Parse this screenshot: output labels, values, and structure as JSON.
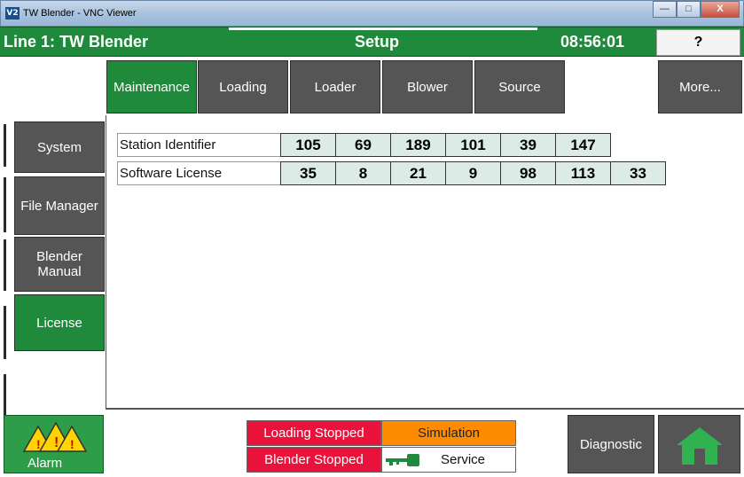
{
  "window": {
    "title": "TW Blender - VNC Viewer",
    "logo_text": "V2",
    "minimize_glyph": "—",
    "maximize_glyph": "□",
    "close_glyph": "X"
  },
  "header": {
    "line_title": "Line 1: TW Blender",
    "screen_title": "Setup",
    "clock": "08:56:01",
    "help_label": "?"
  },
  "tabs": [
    {
      "label": "Maintenance",
      "active": true
    },
    {
      "label": "Loading",
      "active": false
    },
    {
      "label": "Loader",
      "active": false
    },
    {
      "label": "Blower",
      "active": false
    },
    {
      "label": "Source",
      "active": false
    },
    {
      "label": "More...",
      "active": false
    }
  ],
  "sidebar": {
    "items": [
      {
        "label": "System",
        "active": false
      },
      {
        "label": "File Manager",
        "active": false
      },
      {
        "label": "Blender\nManual",
        "active": false
      },
      {
        "label": "License",
        "active": true
      }
    ]
  },
  "license": {
    "station_identifier": {
      "label": "Station Identifier",
      "values": [
        "105",
        "69",
        "189",
        "101",
        "39",
        "147"
      ]
    },
    "software_license": {
      "label": "Software License",
      "values": [
        "35",
        "8",
        "21",
        "9",
        "98",
        "113",
        "33"
      ]
    }
  },
  "footer": {
    "alarm_label": "Alarm",
    "loading_stopped": "Loading Stopped",
    "simulation": "Simulation",
    "blender_stopped": "Blender Stopped",
    "service": "Service",
    "diagnostic": "Diagnostic"
  },
  "colors": {
    "green": "#1f8a3b",
    "button_gray": "#555555",
    "cell_bg": "#dcebe6",
    "status_red": "#e8123a",
    "status_orange": "#ff8c00"
  },
  "icons": {
    "alarm": "warning-triangles-icon",
    "service": "key-icon",
    "home": "home-icon"
  }
}
